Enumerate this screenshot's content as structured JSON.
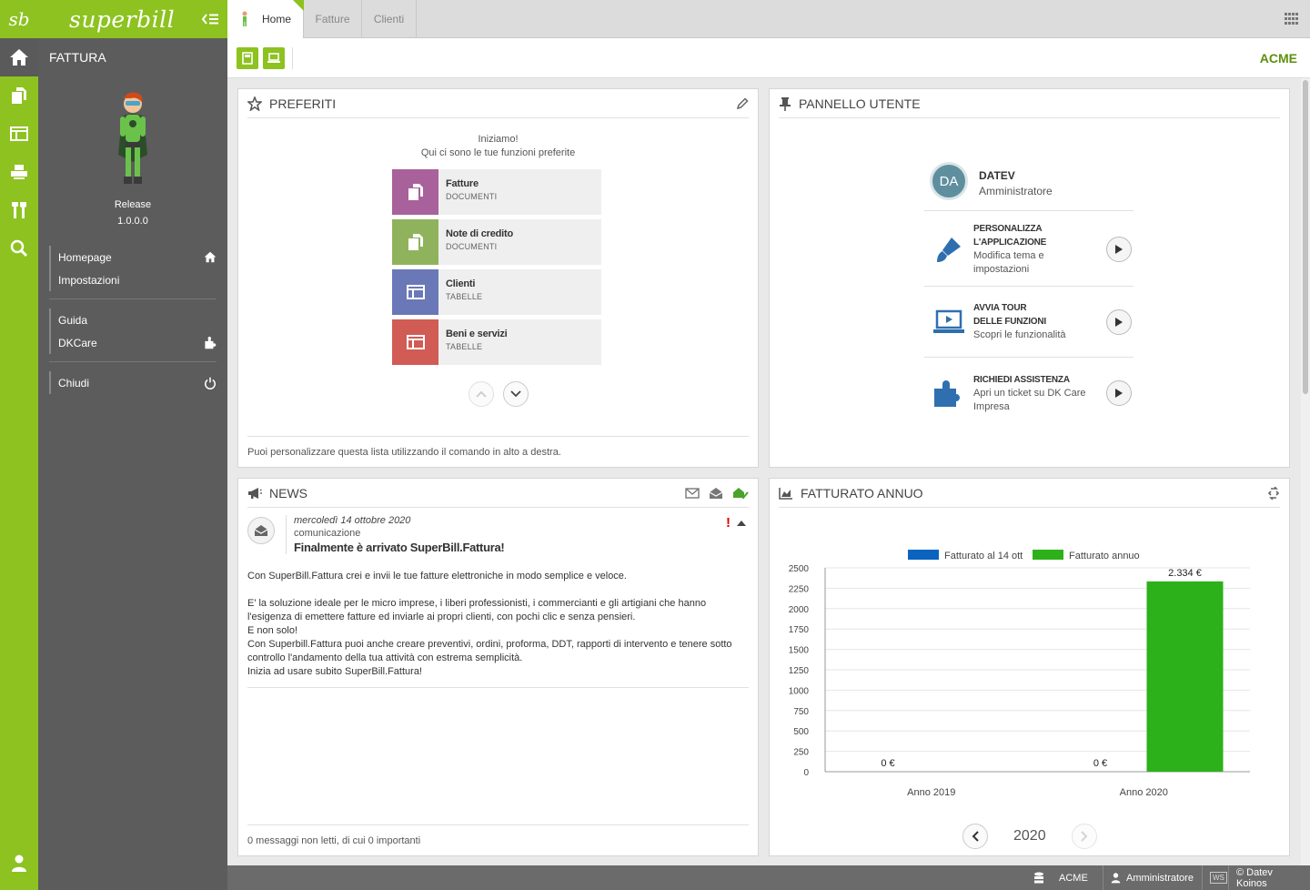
{
  "brand": {
    "logo_glyph": "sb",
    "name": "superbill",
    "accent_color": "#8dc220",
    "dark_color": "#5c5c5c"
  },
  "side": {
    "app_title": "FATTURA",
    "release_label": "Release",
    "release_version": "1.0.0.0",
    "menu": [
      {
        "label": "Homepage",
        "icon": "home-icon"
      },
      {
        "label": "Impostazioni",
        "icon": ""
      },
      {
        "label": "Guida",
        "icon": ""
      },
      {
        "label": "DKCare",
        "icon": "puzzle-icon"
      },
      {
        "label": "Chiudi",
        "icon": "power-icon"
      }
    ]
  },
  "rail_icons": [
    "home-icon",
    "documents-icon",
    "table-icon",
    "printer-icon",
    "tools-icon",
    "search-icon",
    "user-icon"
  ],
  "tabs": [
    {
      "label": "Home",
      "active": true
    },
    {
      "label": "Fatture",
      "active": false
    },
    {
      "label": "Clienti",
      "active": false
    }
  ],
  "toolbar": {
    "company": "ACME"
  },
  "preferiti": {
    "title": "PREFERITI",
    "intro_line1": "Iniziamo!",
    "intro_line2": "Qui ci sono le tue funzioni preferite",
    "items": [
      {
        "title": "Fatture",
        "subtitle": "DOCUMENTI",
        "color": "#a8619b",
        "icon": "documents-icon"
      },
      {
        "title": "Note di credito",
        "subtitle": "DOCUMENTI",
        "color": "#8fb35c",
        "icon": "documents-icon"
      },
      {
        "title": "Clienti",
        "subtitle": "TABELLE",
        "color": "#6a78b8",
        "icon": "table-icon"
      },
      {
        "title": "Beni e servizi",
        "subtitle": "TABELLE",
        "color": "#d15b55",
        "icon": "table-icon"
      }
    ],
    "footer": "Puoi personalizzare questa lista utilizzando il comando in alto a destra."
  },
  "pannello": {
    "title": "PANNELLO UTENTE",
    "user": {
      "initials": "DA",
      "name": "DATEV",
      "role": "Amministratore"
    },
    "actions": [
      {
        "title_line1": "PERSONALIZZA",
        "title_line2": "L'APPLICAZIONE",
        "desc_line1": "Modifica tema e",
        "desc_line2": "impostazioni",
        "icon": "brush-icon"
      },
      {
        "title_line1": "AVVIA TOUR",
        "title_line2": "DELLE FUNZIONI",
        "desc_line1": "Scopri le funzionalità",
        "desc_line2": "",
        "icon": "laptop-icon"
      },
      {
        "title_line1": "RICHIEDI ASSISTENZA",
        "title_line2": "",
        "desc_line1": "Apri un ticket su DK Care",
        "desc_line2": "Impresa",
        "icon": "puzzle-icon"
      }
    ]
  },
  "news": {
    "title": "NEWS",
    "message": {
      "date": "mercoledì 14 ottobre 2020",
      "category": "comunicazione",
      "subject": "Finalmente è arrivato SuperBill.Fattura!",
      "important_mark": "!",
      "body": [
        "Con SuperBill.Fattura crei e invii le tue fatture elettroniche in modo semplice e veloce.",
        "",
        "E' la soluzione ideale per le micro imprese, i liberi professionisti, i commercianti e gli artigiani che hanno l'esigenza di emettere fatture ed inviarle ai propri clienti, con pochi clic e senza pensieri.",
        "E non solo!",
        "Con Superbill.Fattura puoi anche creare preventivi, ordini, proforma, DDT, rapporti di intervento e tenere sotto controllo l'andamento della tua attività con estrema semplicità.",
        "Inizia ad usare subito SuperBill.Fattura!"
      ]
    },
    "footer": "0 messaggi non letti, di cui 0 importanti"
  },
  "fatturato": {
    "title": "FATTURATO ANNUO",
    "year": "2020"
  },
  "chart_data": {
    "type": "bar",
    "title": "",
    "categories": [
      "Anno 2019",
      "Anno 2020"
    ],
    "series": [
      {
        "name": "Fatturato al 14 ott",
        "color": "#0a63bf",
        "values": [
          0,
          0
        ],
        "labels": [
          "0 €",
          "0 €"
        ]
      },
      {
        "name": "Fatturato annuo",
        "color": "#2db11b",
        "values": [
          0,
          2334
        ],
        "labels": [
          "",
          "2.334 €"
        ]
      }
    ],
    "ylim": [
      0,
      2500
    ],
    "yticks": [
      0,
      250,
      500,
      750,
      1000,
      1250,
      1500,
      1750,
      2000,
      2250,
      2500
    ],
    "legend_position": "top",
    "grid": true,
    "xlabel": "",
    "ylabel": ""
  },
  "footer": {
    "company": "ACME",
    "user": "Amministratore",
    "ws_badge": "WS",
    "copyright": "© Datev Koinos"
  }
}
